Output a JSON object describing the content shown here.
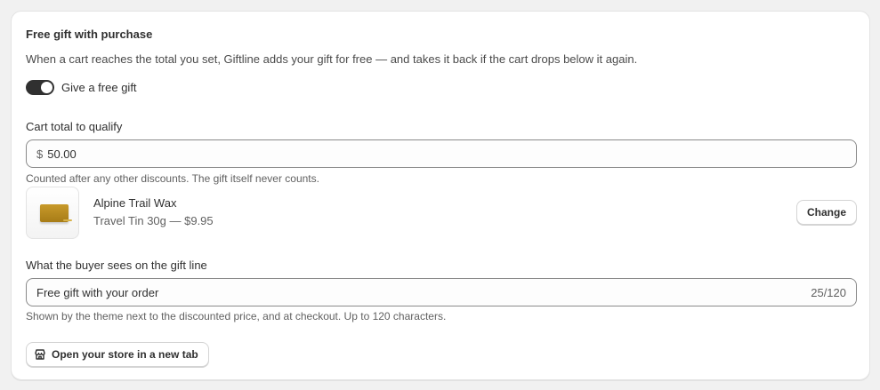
{
  "section": {
    "title": "Free gift with purchase",
    "description": "When a cart reaches the total you set, Giftline adds your gift for free — and takes it back if the cart drops below it again."
  },
  "toggle": {
    "label": "Give a free gift",
    "on": true
  },
  "threshold": {
    "label": "Cart total to qualify",
    "prefix": "$",
    "value": "50.00",
    "help": "Counted after any other discounts. The gift itself never counts."
  },
  "gift_product": {
    "name": "Alpine Trail Wax",
    "variant": "Travel Tin 30g — $9.95",
    "change_label": "Change"
  },
  "gift_line": {
    "label": "What the buyer sees on the gift line",
    "value": "Free gift with your order",
    "counter": "25/120",
    "help": "Shown by the theme next to the discounted price, and at checkout. Up to 120 characters."
  },
  "store_button": {
    "label": "Open your store in a new tab",
    "icon": "storefront-icon"
  },
  "colors": {
    "toggle_on": "#303030",
    "background": "#f1f1f1",
    "card": "#ffffff"
  }
}
